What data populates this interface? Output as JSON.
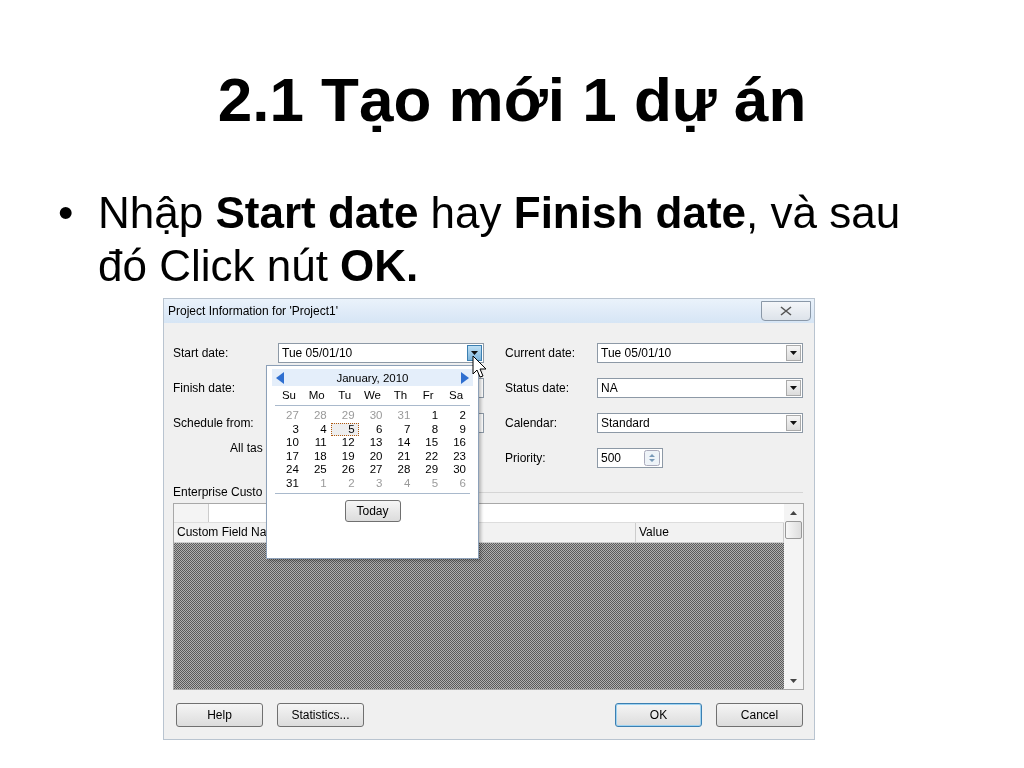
{
  "slide": {
    "title": "2.1 Tạo mới 1 dự án",
    "bullet_mark": "•",
    "bullet": "Nhập **Start date** hay **Finish date**, và sau đó Click nút **OK.**"
  },
  "dialog": {
    "title": "Project Information for 'Project1'",
    "left_fields": [
      {
        "label": "Start date:",
        "value": "Tue 05/01/10"
      },
      {
        "label": "Finish date:"
      },
      {
        "label": "Schedule from:"
      }
    ],
    "note": "All tas",
    "section_label": "Enterprise Custo",
    "right_fields": [
      {
        "label": "Current date:",
        "value": "Tue 05/01/10",
        "kind": "dropdown"
      },
      {
        "label": "Status date:",
        "value": "NA",
        "kind": "dropdown"
      },
      {
        "label": "Calendar:",
        "value": "Standard",
        "kind": "dropdown"
      },
      {
        "label": "Priority:",
        "value": "500",
        "kind": "spinner"
      }
    ],
    "grid": {
      "columns": [
        "Custom Field Na",
        "Value"
      ]
    },
    "buttons": [
      {
        "label": "Help",
        "default": false
      },
      {
        "label": "Statistics...",
        "default": false
      },
      {
        "label": "OK",
        "default": true
      },
      {
        "label": "Cancel",
        "default": false
      }
    ],
    "calendar": {
      "month": "January, 2010",
      "weekdays": [
        "Su",
        "Mo",
        "Tu",
        "We",
        "Th",
        "Fr",
        "Sa"
      ],
      "days": [
        {
          "d": "27",
          "muted": true,
          "selected": false
        },
        {
          "d": "28",
          "muted": true,
          "selected": false
        },
        {
          "d": "29",
          "muted": true,
          "selected": false
        },
        {
          "d": "30",
          "muted": true,
          "selected": false
        },
        {
          "d": "31",
          "muted": true,
          "selected": false
        },
        {
          "d": "1",
          "muted": false,
          "selected": false
        },
        {
          "d": "2",
          "muted": false,
          "selected": false
        },
        {
          "d": "3",
          "muted": false,
          "selected": false
        },
        {
          "d": "4",
          "muted": false,
          "selected": false
        },
        {
          "d": "5",
          "muted": false,
          "selected": true
        },
        {
          "d": "6",
          "muted": false,
          "selected": false
        },
        {
          "d": "7",
          "muted": false,
          "selected": false
        },
        {
          "d": "8",
          "muted": false,
          "selected": false
        },
        {
          "d": "9",
          "muted": false,
          "selected": false
        },
        {
          "d": "10",
          "muted": false,
          "selected": false
        },
        {
          "d": "11",
          "muted": false,
          "selected": false
        },
        {
          "d": "12",
          "muted": false,
          "selected": false
        },
        {
          "d": "13",
          "muted": false,
          "selected": false
        },
        {
          "d": "14",
          "muted": false,
          "selected": false
        },
        {
          "d": "15",
          "muted": false,
          "selected": false
        },
        {
          "d": "16",
          "muted": false,
          "selected": false
        },
        {
          "d": "17",
          "muted": false,
          "selected": false
        },
        {
          "d": "18",
          "muted": false,
          "selected": false
        },
        {
          "d": "19",
          "muted": false,
          "selected": false
        },
        {
          "d": "20",
          "muted": false,
          "selected": false
        },
        {
          "d": "21",
          "muted": false,
          "selected": false
        },
        {
          "d": "22",
          "muted": false,
          "selected": false
        },
        {
          "d": "23",
          "muted": false,
          "selected": false
        },
        {
          "d": "24",
          "muted": false,
          "selected": false
        },
        {
          "d": "25",
          "muted": false,
          "selected": false
        },
        {
          "d": "26",
          "muted": false,
          "selected": false
        },
        {
          "d": "27",
          "muted": false,
          "selected": false
        },
        {
          "d": "28",
          "muted": false,
          "selected": false
        },
        {
          "d": "29",
          "muted": false,
          "selected": false
        },
        {
          "d": "30",
          "muted": false,
          "selected": false
        },
        {
          "d": "31",
          "muted": false,
          "selected": false
        },
        {
          "d": "1",
          "muted": true,
          "selected": false
        },
        {
          "d": "2",
          "muted": true,
          "selected": false
        },
        {
          "d": "3",
          "muted": true,
          "selected": false
        },
        {
          "d": "4",
          "muted": true,
          "selected": false
        },
        {
          "d": "5",
          "muted": true,
          "selected": false
        },
        {
          "d": "6",
          "muted": true,
          "selected": false
        }
      ],
      "today_button": "Today"
    }
  }
}
